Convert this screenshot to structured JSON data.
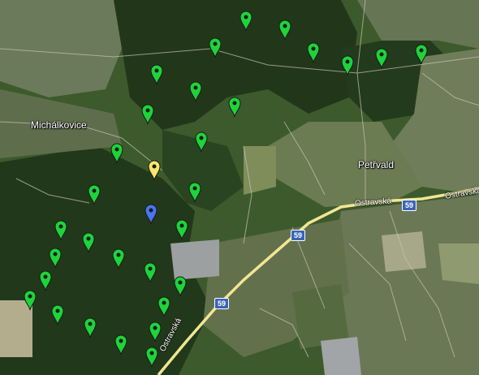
{
  "places": {
    "michalkovice": "Michálkovice",
    "petrvald": "Petřvald"
  },
  "roads": {
    "ostravska_east": "Ostravská",
    "ostravska_mid": "Ostravská",
    "ostravska_south": "Ostravská",
    "route_number": "59"
  },
  "markers": {
    "colors": {
      "green": "#1dd43a",
      "yellow": "#f6e66a",
      "blue": "#4a74f0"
    },
    "counts": {
      "green": 33,
      "yellow": 1,
      "blue": 1
    }
  }
}
